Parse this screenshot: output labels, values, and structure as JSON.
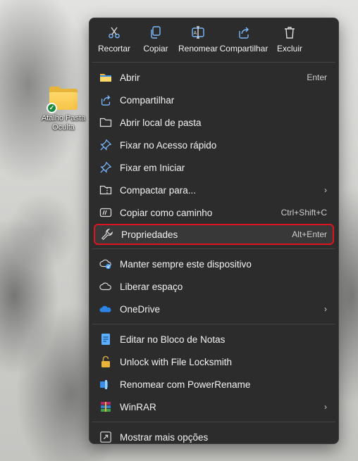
{
  "desktop": {
    "icon_label_line1": "Atalho Pasta",
    "icon_label_line2": "Oculta"
  },
  "toolbar": {
    "cut": "Recortar",
    "copy": "Copiar",
    "rename": "Renomear",
    "share": "Compartilhar",
    "delete": "Excluir"
  },
  "menu": {
    "group1": [
      {
        "label": "Abrir",
        "shortcut": "Enter",
        "icon": "folder-open-icon"
      },
      {
        "label": "Compartilhar",
        "shortcut": "",
        "icon": "share-icon"
      },
      {
        "label": "Abrir local de pasta",
        "shortcut": "",
        "icon": "folder-outline-icon"
      },
      {
        "label": "Fixar no Acesso rápido",
        "shortcut": "",
        "icon": "pin-icon"
      },
      {
        "label": "Fixar em Iniciar",
        "shortcut": "",
        "icon": "pin-icon"
      },
      {
        "label": "Compactar para...",
        "shortcut": "",
        "icon": "zip-folder-icon",
        "submenu": true
      },
      {
        "label": "Copiar como caminho",
        "shortcut": "Ctrl+Shift+C",
        "icon": "path-icon"
      },
      {
        "label": "Propriedades",
        "shortcut": "Alt+Enter",
        "icon": "wrench-icon"
      }
    ],
    "group2": [
      {
        "label": "Manter sempre este dispositivo",
        "icon": "cloud-sync-icon"
      },
      {
        "label": "Liberar espaço",
        "icon": "cloud-icon"
      },
      {
        "label": "OneDrive",
        "icon": "onedrive-icon",
        "submenu": true
      }
    ],
    "group3": [
      {
        "label": "Editar no Bloco de Notas",
        "icon": "notepad-icon"
      },
      {
        "label": "Unlock with File Locksmith",
        "icon": "lock-icon"
      },
      {
        "label": "Renomear com PowerRename",
        "icon": "powerrename-icon"
      },
      {
        "label": "WinRAR",
        "icon": "winrar-icon",
        "submenu": true
      }
    ],
    "group4": [
      {
        "label": "Mostrar mais opções",
        "icon": "more-options-icon"
      }
    ],
    "chevron": "›"
  },
  "colors": {
    "menu_bg": "#2c2c2c",
    "highlight_border": "#e0141e",
    "accent_blue": "#4aa3ff"
  }
}
